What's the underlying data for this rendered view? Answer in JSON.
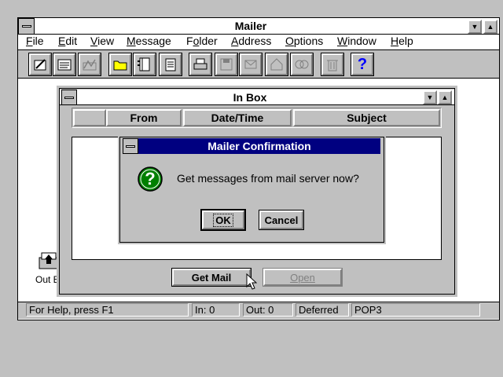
{
  "app": {
    "title": "Mailer",
    "menu": [
      {
        "label": "File",
        "key": "F"
      },
      {
        "label": "Edit",
        "key": "E"
      },
      {
        "label": "View",
        "key": "V"
      },
      {
        "label": "Message",
        "key": "M"
      },
      {
        "label": "Folder",
        "key": "o"
      },
      {
        "label": "Address",
        "key": "A"
      },
      {
        "label": "Options",
        "key": "O"
      },
      {
        "label": "Window",
        "key": "W"
      },
      {
        "label": "Help",
        "key": "H"
      }
    ],
    "toolbar": [
      {
        "icon": "compose-icon"
      },
      {
        "icon": "read-message-icon"
      },
      {
        "icon": "signature-icon"
      },
      {
        "icon": "open-folder-icon"
      },
      {
        "icon": "address-book-icon"
      },
      {
        "icon": "notepad-icon"
      },
      {
        "icon": "print-icon"
      },
      {
        "icon": "save-icon"
      },
      {
        "icon": "forward-icon"
      },
      {
        "icon": "reply-icon"
      },
      {
        "icon": "reply-all-icon"
      },
      {
        "icon": "trash-icon"
      },
      {
        "icon": "help-icon",
        "text": "?"
      }
    ]
  },
  "desktop_icon": {
    "label": "Out Bo"
  },
  "inbox": {
    "title": "In Box",
    "columns": [
      "From",
      "Date/Time",
      "Subject"
    ],
    "get_mail_label": "Get Mail",
    "open_label": "Open"
  },
  "dialog": {
    "title": "Mailer Confirmation",
    "message": "Get messages from mail server now?",
    "ok_label": "OK",
    "cancel_label": "Cancel",
    "icon_text": "?"
  },
  "statusbar": {
    "help": "For Help, press F1",
    "in": "In: 0",
    "out": "Out: 0",
    "mode": "Deferred",
    "protocol": "POP3"
  },
  "colors": {
    "dialog_title_bg": "#000080",
    "question_icon": "#008000",
    "help_icon": "#0000ff"
  }
}
